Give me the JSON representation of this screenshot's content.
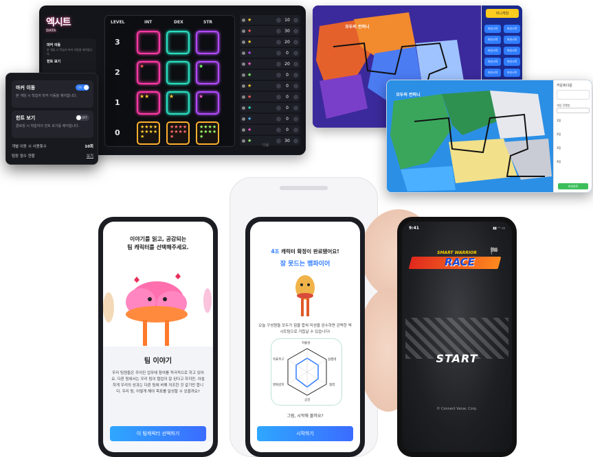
{
  "dashboard": {
    "logo": "엑시트",
    "logo_sub": "DATA",
    "columns": [
      "LEVEL",
      "INT",
      "DEX",
      "STR"
    ],
    "levels": [
      "3",
      "2",
      "1",
      "0"
    ],
    "rows": [
      {
        "value": "10"
      },
      {
        "value": "30"
      },
      {
        "value": "20"
      },
      {
        "value": "0"
      },
      {
        "value": "20"
      },
      {
        "value": "0"
      },
      {
        "value": "0"
      },
      {
        "value": "0"
      },
      {
        "value": "0"
      },
      {
        "value": "0"
      },
      {
        "value": "0"
      },
      {
        "value": "30"
      }
    ],
    "mini_side": {
      "item1": "마커 이동",
      "item1_desc": "본 게임 시 학습자 마커 이동을 제어합니다.",
      "item2": "힌트 보기"
    },
    "footer_text": "다음"
  },
  "settings_card": {
    "marker_title": "마커 이동",
    "marker_desc": "본 게임 시 학습자 마커 이동을 제어합니다.",
    "marker_toggle": "ON",
    "hint_title": "힌트 보기",
    "hint_desc": "클로징 시 학습자의 힌트 보기를 제어합니다.",
    "hint_toggle": "OFF",
    "usage_label": "개별 이동 시 사용횟수",
    "usage_value": "10회",
    "score_label": "팀장 점수 현황",
    "score_link": "보기"
  },
  "map1": {
    "logo": "모두의 컨퍼니",
    "top_button": "미니게임",
    "side_buttons": [
      "미션시작",
      "미션시작",
      "미션시작",
      "미션시작",
      "미션시작",
      "미션시작",
      "미션시작",
      "미션시작",
      "미션시작",
      "미션시작"
    ]
  },
  "map2": {
    "logo": "모두의 컨퍼니",
    "panel_title": "카운트다운",
    "panel_select_label": "게임 진행방",
    "panel_items": [
      "1팀",
      "2팀",
      "3팀",
      "4팀"
    ],
    "panel_button": "미션완료"
  },
  "phone1": {
    "heading_line1": "이야기를 읽고, 공감되는",
    "heading_line2": "팀 캐릭터를 선택해주세요.",
    "story_title": "팀 이야기",
    "story_body": "우리 팀원들은 주어진 업무에 참여를 적극적으로 하고 있어요. 다른 팀에서는 우리 팀이 협업이 잘 된다고 하지만, 아쉽하게 우리의 성과는 다른 팀에 비해 저조한 것 같기만 합니다. 우리 팀, 어떻게 해야 목표를 달성할 수 있을까요?",
    "button": "이 팀캐릭터 선택하기"
  },
  "phone2": {
    "heading_prefix": "4조",
    "heading_rest": "캐릭터 확정이 완료됐어요!",
    "character_name": "잠 못드는 뱀파이어",
    "desc": "오늘 구성원들 모두가 힘을 합쳐 미션을 완수하면 강력한 엑시트팀으로 거듭날 수 있습니다!",
    "radar_labels": [
      "자율성",
      "실행력",
      "협력",
      "공감",
      "변화감지",
      "목표추구"
    ],
    "question": "그럼, 시작해 볼까요?",
    "button": "시작하기"
  },
  "phone3": {
    "time": "9:41",
    "title_top": "SMART WARRIOR",
    "title_main": "RACE",
    "start": "START",
    "copyright": "© Connect Value, Corp."
  },
  "colors": {
    "accent_blue": "#2f7cff",
    "neon_pink": "#ff3aa7",
    "neon_teal": "#2ae0c2",
    "neon_purple": "#b34bff",
    "race_red": "#e0281e"
  }
}
